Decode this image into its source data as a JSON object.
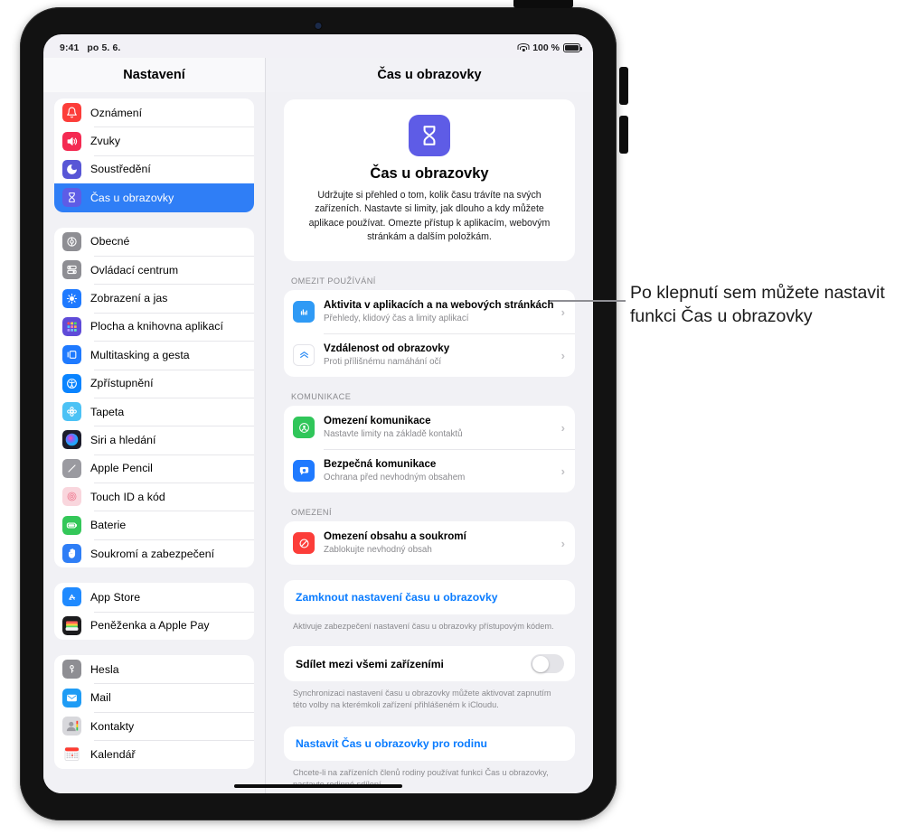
{
  "status_bar": {
    "time": "9:41",
    "date": "po 5. 6.",
    "battery_percent": "100 %",
    "wifi_icon": "wifi-icon",
    "battery_icon": "battery-full-icon"
  },
  "sidebar": {
    "title": "Nastavení",
    "groups": [
      {
        "items": [
          {
            "label": "Oznámení",
            "icon": "bell-icon",
            "color": "#fc3d39",
            "selected": false
          },
          {
            "label": "Zvuky",
            "icon": "speaker-waves-icon",
            "color": "#f42a52",
            "selected": false
          },
          {
            "label": "Soustředění",
            "icon": "moon-icon",
            "color": "#5856d6",
            "selected": false
          },
          {
            "label": "Čas u obrazovky",
            "icon": "hourglass-icon",
            "color": "#5e5ce6",
            "selected": true
          }
        ]
      },
      {
        "items": [
          {
            "label": "Obecné",
            "icon": "gear-icon",
            "color": "#8e8e93",
            "selected": false
          },
          {
            "label": "Ovládací centrum",
            "icon": "sliders-icon",
            "color": "#8e8e93",
            "selected": false
          },
          {
            "label": "Zobrazení a jas",
            "icon": "brightness-icon",
            "color": "#1f7aff",
            "selected": false
          },
          {
            "label": "Plocha a knihovna aplikací",
            "icon": "app-grid-icon",
            "color": "#5f4bd8",
            "selected": false
          },
          {
            "label": "Multitasking a gesta",
            "icon": "multitasking-icon",
            "color": "#1f7aff",
            "selected": false
          },
          {
            "label": "Zpřístupnění",
            "icon": "accessibility-icon",
            "color": "#0a84ff",
            "selected": false
          },
          {
            "label": "Tapeta",
            "icon": "flower-icon",
            "color": "#4cc2f5",
            "selected": false
          },
          {
            "label": "Siri a hledání",
            "icon": "siri-icon",
            "color": "#1c1c2b",
            "selected": false
          },
          {
            "label": "Apple Pencil",
            "icon": "pencil-icon",
            "color": "#9a9aa0",
            "selected": false
          },
          {
            "label": "Touch ID a kód",
            "icon": "fingerprint-icon",
            "color": "#f9d6dd",
            "selected": false
          },
          {
            "label": "Baterie",
            "icon": "battery-icon",
            "color": "#34c759",
            "selected": false
          },
          {
            "label": "Soukromí a zabezpečení",
            "icon": "hand-raised-icon",
            "color": "#2f7ef6",
            "selected": false
          }
        ]
      },
      {
        "items": [
          {
            "label": "App Store",
            "icon": "app-store-icon",
            "color": "#1f8aff",
            "selected": false
          },
          {
            "label": "Peněženka a Apple Pay",
            "icon": "wallet-icon",
            "color": "#1c1c1e",
            "selected": false
          }
        ]
      },
      {
        "items": [
          {
            "label": "Hesla",
            "icon": "key-icon",
            "color": "#8e8e93",
            "selected": false
          },
          {
            "label": "Mail",
            "icon": "mail-icon",
            "color": "#1f9cf5",
            "selected": false
          },
          {
            "label": "Kontakty",
            "icon": "contacts-icon",
            "color": "#d8d8dc",
            "selected": false
          },
          {
            "label": "Kalendář",
            "icon": "calendar-icon",
            "color": "#ffffff",
            "selected": false
          }
        ]
      }
    ]
  },
  "detail": {
    "title": "Čas u obrazovky",
    "hero": {
      "icon": "hourglass-icon",
      "icon_color": "#5e5ce6",
      "title": "Čas u obrazovky",
      "description": "Udržujte si přehled o tom, kolik času trávíte na svých zařízeních. Nastavte si limity, jak dlouho a kdy můžete aplikace používat. Omezte přístup k aplikacím, webovým stránkám a dalším položkám."
    },
    "sections": [
      {
        "header": "OMEZIT POUŽÍVÁNÍ",
        "rows": [
          {
            "title": "Aktivita v aplikacích a na webových stránkách",
            "subtitle": "Přehledy, klidový čas a limity aplikací",
            "icon": "bar-chart-icon",
            "color": "#2f9af5"
          },
          {
            "title": "Vzdálenost od obrazovky",
            "subtitle": "Proti přílišnému namáhání očí",
            "icon": "chevrons-up-icon",
            "color": "#ffffff"
          }
        ]
      },
      {
        "header": "KOMUNIKACE",
        "rows": [
          {
            "title": "Omezení komunikace",
            "subtitle": "Nastavte limity na základě kontaktů",
            "icon": "person-circle-icon",
            "color": "#30c65a"
          },
          {
            "title": "Bezpečná komunikace",
            "subtitle": "Ochrana před nevhodným obsahem",
            "icon": "message-shield-icon",
            "color": "#1f7aff"
          }
        ]
      },
      {
        "header": "OMEZENÍ",
        "rows": [
          {
            "title": "Omezení obsahu a soukromí",
            "subtitle": "Zablokujte nevhodný obsah",
            "icon": "no-entry-icon",
            "color": "#fc3d39"
          }
        ]
      }
    ],
    "lock_link": "Zamknout nastavení času u obrazovky",
    "lock_footnote": "Aktivuje zabezpečení nastavení času u obrazovky přístupovým kódem.",
    "share_toggle": {
      "label": "Sdílet mezi všemi zařízeními",
      "state": "off",
      "footnote": "Synchronizaci nastavení času u obrazovky můžete aktivovat zapnutím této volby na kterémkoli zařízení přihlášeném k iCloudu."
    },
    "family_link": "Nastavit Čas u obrazovky pro rodinu",
    "family_footnote": "Chcete-li na zařízeních členů rodiny používat funkci Čas u obrazovky, nastavte rodinné sdílení."
  },
  "callout": {
    "text": "Po klepnutí sem můžete nastavit funkci Čas u obrazovky"
  },
  "colors": {
    "accent": "#0a7cff",
    "selection": "#2f7ef6",
    "screen_bg": "#f1f1f5"
  }
}
